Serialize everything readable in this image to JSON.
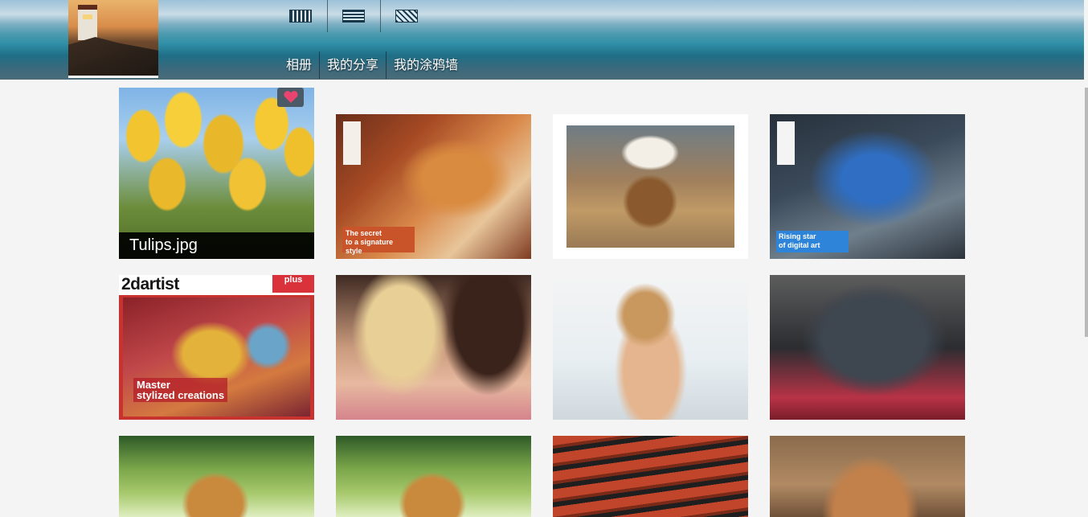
{
  "header": {
    "nav": [
      {
        "label": "相册"
      },
      {
        "label": "我的分享"
      },
      {
        "label": "我的涂鸦墙"
      }
    ],
    "top_icons": [
      "tile-icon-1",
      "tile-icon-2",
      "tile-icon-3"
    ]
  },
  "gallery": {
    "items": [
      {
        "name": "tulips",
        "caption": "Tulips.jpg",
        "liked": true
      },
      {
        "name": "leopard-poster",
        "overlay_text": "The secret\nto a signature style"
      },
      {
        "name": "doll-painting"
      },
      {
        "name": "dragon-poster",
        "overlay_text": "Rising star\nof digital art"
      },
      {
        "name": "2dartist-magazine",
        "title": "2dartist",
        "badge": "plus",
        "headline": "Master\nstylized creations"
      },
      {
        "name": "two-women"
      },
      {
        "name": "beach-girl"
      },
      {
        "name": "dog"
      },
      {
        "name": "golden-retriever-1"
      },
      {
        "name": "golden-retriever-2"
      },
      {
        "name": "hot-dogs"
      },
      {
        "name": "gopher"
      }
    ]
  },
  "colors": {
    "page_bg": "#f4f4f4",
    "like_heart": "#e8446f",
    "like_bg": "#4a5a66"
  }
}
